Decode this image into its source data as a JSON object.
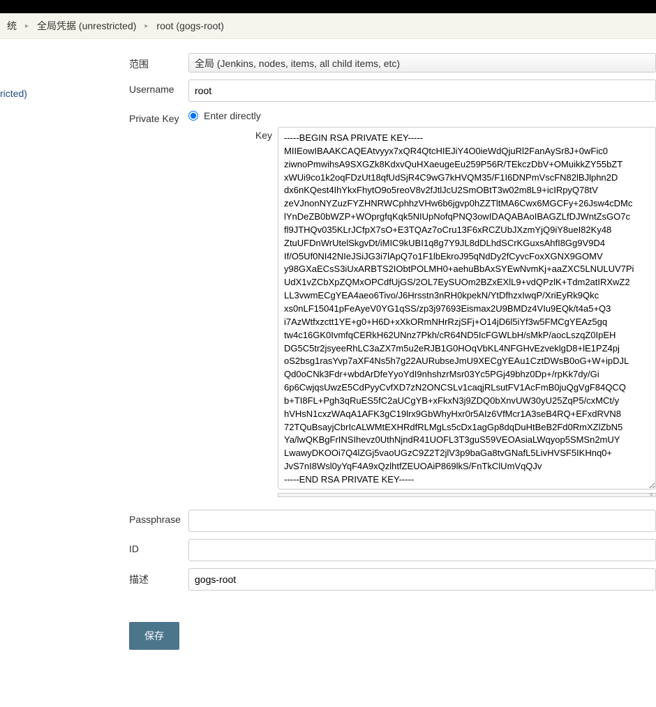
{
  "breadcrumb": {
    "item1": "统",
    "item2": "全局凭据 (unrestricted)",
    "item3": "root (gogs-root)"
  },
  "sidebar": {
    "link": "ricted)"
  },
  "form": {
    "scope": {
      "label": "范围",
      "value": "全局 (Jenkins, nodes, items, all child items, etc)"
    },
    "username": {
      "label": "Username",
      "value": "root"
    },
    "privateKey": {
      "label": "Private Key",
      "radioLabel": "Enter directly",
      "keyLabel": "Key",
      "keyValue": "-----BEGIN RSA PRIVATE KEY-----\nMIIEowIBAAKCAQEAtvyyx7xQR4QtcHIEJiY4O0ieWdQjuRl2FanAySr8J+0wFic0\nziwnoPmwihsA9SXGZk8KdxvQuHXaeugeEu259P56R/TEkczDbV+OMuikkZY55bZT\nxWUi9co1k2oqFDzUt18qfUdSjR4C9wG7kHVQM35/F1I6DNPmVscFN82lBJlphn2D\ndx6nKQest4IhYkxFhytO9o5reoV8v2fJtlJcU2SmOBtT3w02m8L9+icIRpyQ78tV\nzeVJnonNYZuzFYZHNRWCphhzVHw6b6jgvp0hZZTltMA6Cwx6MGCFy+26Jsw4cDMc\nlYnDeZB0bWZP+WOprgfqKqk5NIUpNofqPNQ3owIDAQABAoIBAGZLfDJWntZsGO7c\nfl9JTHQv035KLrJCfpX7sO+E3TQAz7oCru13F6xRCZUbJXzmYjQ9iY8ueI82Ky48\nZtuUFDnWrUtelSkgvDt/iMIC9kUBI1q8g7Y9JL8dDLhdSCrKGuxsAhfI8Gg9V9D4\nIf/O5Uf0NI42NIeJSiJG3i7lApQ7o1F1lbEkroJ95qNdDy2fCyvcFoxXGNX9GOMV\ny98GXaECsS3iUxARBTS2IObtPOLMH0+aehuBbAxSYEwNvmKj+aaZXC5LNULUV7Pi\nUdX1vZCbXpZQMxOPCdfUjGS/2OL7EySUOm2BZxEXlL9+vdQPzlK+Tdm2atIRXwZ2\nLL3vwmECgYEA4aeo6Tivo/J6Hrsstn3nRH0kpekN/YtDfhzxIwqP/XriEyRk9Qkc\nxs0nLF15041pFeAyeV0YG1qSS/zp3j97693Eismax2U9BMDz4VIu9EQk/t4a5+Q3\ni7AzWtfxzctt1YE+g0+H6D+xXkORmNHrRzjSFj+O14jD6l5iYf3w5FMCgYEAz5gq\ntw4c16GK0IvmfqCERkH62UNnz7Pkh/cR64ND5IcFGWLbH/sMkP/aocLszqZ0IpEH\nDG5C5tr2jsyeeRhLC3aZX7m5u2eRJB1G0HOqVbKL4NFGHvEzveklgD8+lE1PZ4pj\noS2bsg1rasYvp7aXF4Ns5h7g22AURubseJmU9XECgYEAu1CztDWsB0oG+W+ipDJL\nQd0oCNk3Fdr+wbdArDfeYyoYdI9nhshzrMsr03Yc5PGj49bhz0Dp+/rpKk7dy/Gi\n6p6CwjqsUwzE5CdPyyCvfXD7zN2ONCSLv1caqjRLsutFV1AcFmB0juQgVgF84QCQ\nb+TI8FL+Pgh3qRuES5fC2aUCgYB+xFkxN3j9ZDQ0bXnvUW30yU25ZqP5/cxMCt/y\nhVHsN1cxzWAqA1AFK3gC19lrx9GbWhyHxr0r5AIz6VfMcr1A3seB4RQ+EFxdRVN8\n72TQuBsayjCbrIcALWMtEXHRdfRLMgLs5cDx1agGp8dqDuHtBeB2Fd0RmXZlZbN5\nYa/lwQKBgFrINSIhevz0UthNjndR41UOFL3T3guS59VEOAsiaLWqyop5SMSn2mUY\nLwawyDKOOi7Q4lZGj5vaoUGzC9Z2T2jlV3p9baGa8tvGNafL5LivHVSF5IKHnq0+\nJvS7nI8Wsl0yYqF4A9xQzlhtfZEUOAiP869lkS/FnTkClUmVqQJv\n-----END RSA PRIVATE KEY-----"
    },
    "passphrase": {
      "label": "Passphrase",
      "value": ""
    },
    "id": {
      "label": "ID",
      "value": ""
    },
    "description": {
      "label": "描述",
      "value": "gogs-root"
    },
    "saveButton": "保存"
  }
}
